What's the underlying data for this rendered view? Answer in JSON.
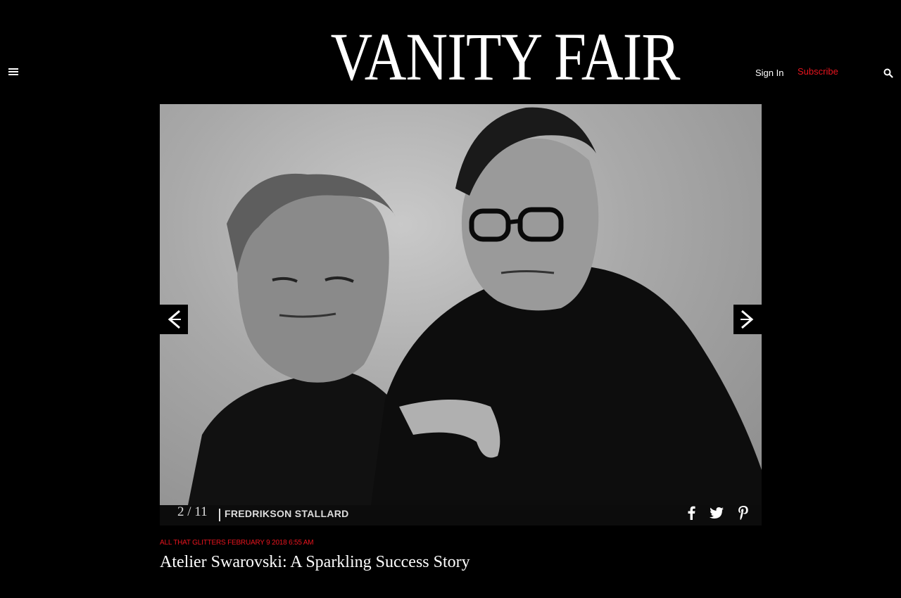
{
  "header": {
    "logo": "VANITY FAIR",
    "sign_in": "Sign In",
    "subscribe": "Subscribe"
  },
  "gallery": {
    "counter": "2 / 11",
    "credit": "FREDRIKSON STALLARD",
    "photo_alt": "Black and white portrait of two men"
  },
  "article": {
    "section": "ALL THAT GLITTERS",
    "date": "FEBRUARY 9 2018 6:55 AM",
    "headline": "Atelier Swarovski: A Sparkling Success Story"
  },
  "colors": {
    "background": "#000000",
    "accent": "#e8141e",
    "text": "#ffffff"
  },
  "icons": [
    "menu-icon",
    "search-icon",
    "chevron-left-icon",
    "chevron-right-icon",
    "facebook-icon",
    "twitter-icon",
    "pinterest-icon"
  ]
}
